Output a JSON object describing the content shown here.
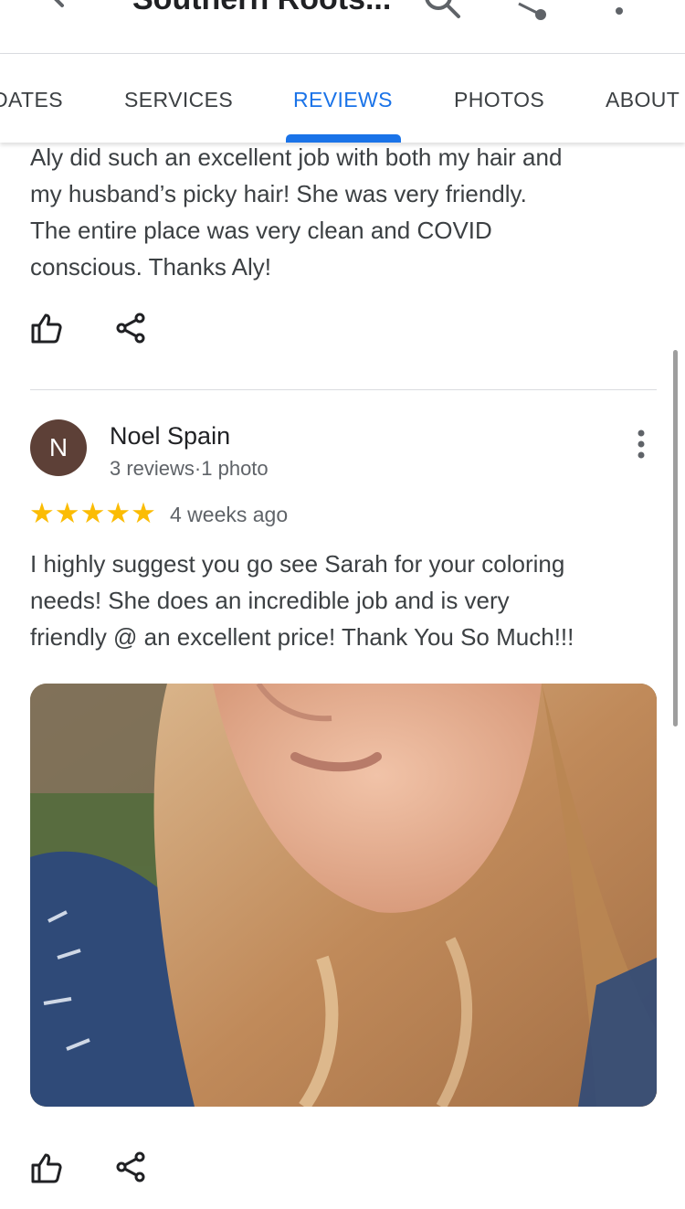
{
  "appbar": {
    "title": "Southern Roots...",
    "icons": [
      "back-arrow-icon",
      "search-icon",
      "share-icon",
      "more-vert-icon"
    ]
  },
  "tabs": [
    {
      "label": "DATES",
      "active": false
    },
    {
      "label": "SERVICES",
      "active": false
    },
    {
      "label": "REVIEWS",
      "active": true
    },
    {
      "label": "PHOTOS",
      "active": false
    },
    {
      "label": "ABOUT",
      "active": false
    }
  ],
  "colors": {
    "accent": "#1a73e8",
    "star": "#fbbc04",
    "avatar_bg": "#5d4037"
  },
  "reviews": [
    {
      "text_lines": [
        "Aly did such an excellent job with both my hair and",
        "my husband’s picky hair! She was very friendly.",
        "The entire place was very clean and COVID",
        "conscious. Thanks Aly!"
      ],
      "actions": [
        "thumb-up-icon",
        "share-icon"
      ]
    },
    {
      "avatar_letter": "N",
      "name": "Noel Spain",
      "meta": "3 reviews·1 photo",
      "rating": 5,
      "stars": "★★★★★",
      "date": "4 weeks ago",
      "text_lines": [
        "I highly suggest you go see Sarah for your coloring",
        "needs! She does an incredible job and is very",
        "friendly @ an excellent price! Thank You So Much!!!"
      ],
      "photo": "review-photo",
      "actions": [
        "thumb-up-icon",
        "share-icon"
      ]
    }
  ]
}
